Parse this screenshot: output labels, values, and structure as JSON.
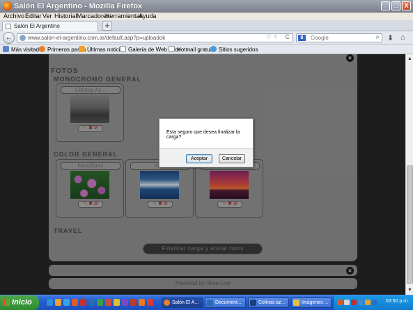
{
  "window": {
    "title": "Salón El Argentino - Mozilla Firefox",
    "minimize": "_",
    "maximize": "□",
    "close": "X"
  },
  "menu": [
    "Archivo",
    "Editar",
    "Ver",
    "Historial",
    "Marcadores",
    "Herramientas",
    "Ayuda"
  ],
  "tab": {
    "label": "Salón El Argentino",
    "new_tab": "+"
  },
  "nav": {
    "back": "←",
    "url": "www.salon-el-argentino.com.ar/default.asp?p=uploadok",
    "star": "☆ ▿",
    "reload": "C",
    "search_engine": "8",
    "search_placeholder": "Google",
    "search_button": "⌕",
    "download_icon": "⬇",
    "home_icon": "⌂"
  },
  "bookmarks": [
    "Más visitados",
    "Primeros pasos",
    "Últimas noticias",
    "Galería de Web Slice",
    "Hotmail gratuito",
    "Sitios sugeridos"
  ],
  "page": {
    "close_glyph": "×",
    "heading": "FOTOS",
    "sections": [
      {
        "title": "MONOCROMO GENERAL",
        "cards": [
          {
            "name": "Colinas Az...",
            "image": "monochrome-hills"
          }
        ]
      },
      {
        "title": "COLOR GENERAL",
        "cards": [
          {
            "name": "Nenúfares",
            "image": "water-lilies"
          },
          {
            "name": "Inv...",
            "image": "ocean-wave"
          },
          {
            "name": "",
            "image": "sunset"
          }
        ]
      },
      {
        "title": "TRAVEL",
        "cards": []
      }
    ],
    "card_actions": [
      "✎",
      "✖",
      "⊘"
    ],
    "finalize_button": "Finalizar carga y enviar fotos",
    "footer": "Powered by SilverLink"
  },
  "dialog": {
    "message": "Esta seguro que desea finalizar la carga?",
    "ok": "Aceptar",
    "cancel": "Cancelar"
  },
  "taskbar": {
    "start": "Inicio",
    "tasks": [
      "Salón El A...",
      "Document...",
      "Colinas az...",
      "Imágenes ..."
    ],
    "clock": "03:50 p.m."
  }
}
